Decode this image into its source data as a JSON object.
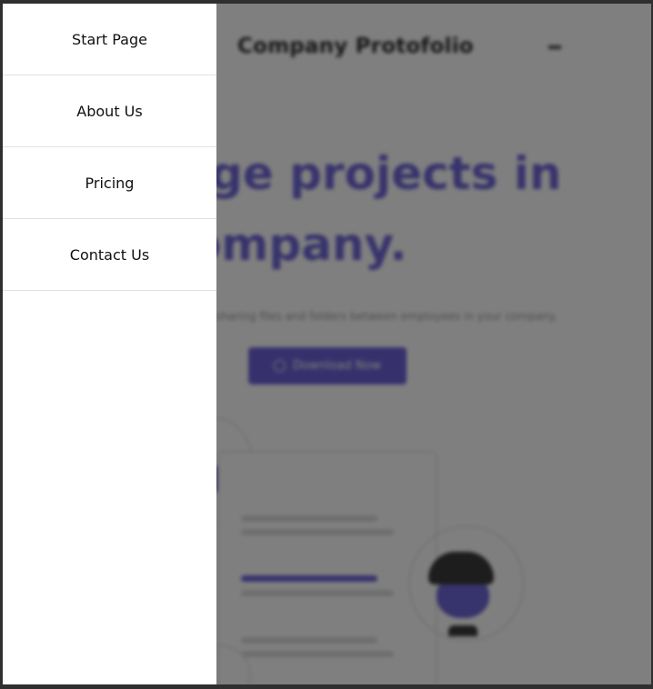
{
  "drawer": {
    "items": [
      {
        "label": "Start Page"
      },
      {
        "label": "About Us"
      },
      {
        "label": "Pricing"
      },
      {
        "label": "Contact Us"
      }
    ]
  },
  "page": {
    "brand": "Company Protofolio",
    "hero_line1": "anage projects in",
    "hero_line2": "e company.",
    "subtitle": "r sharing files and folders between employees in your company.",
    "download_label": "Download Now",
    "download_icon": "download-icon"
  },
  "colors": {
    "accent": "#6c63d9",
    "overlay": "rgba(0,0,0,0.5)",
    "drawer_bg": "#ffffff"
  }
}
